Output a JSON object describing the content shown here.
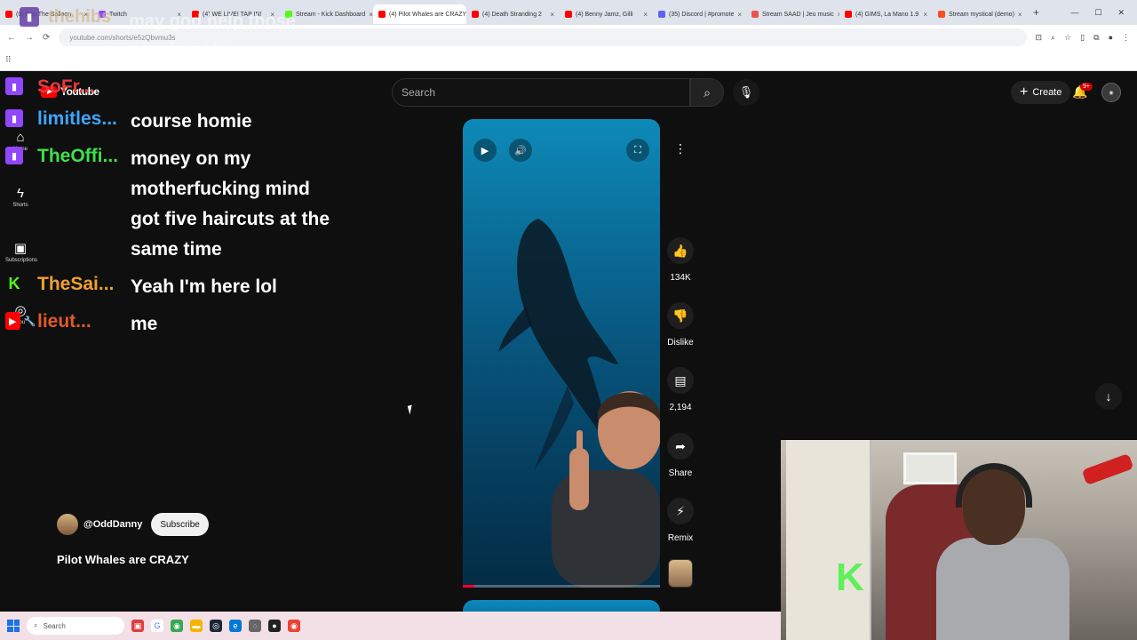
{
  "browser": {
    "tabs": [
      {
        "label": "(0) Pop The Balloon",
        "color": "#ff0000",
        "active": false
      },
      {
        "label": "Twitch",
        "color": "#9146ff",
        "active": false
      },
      {
        "label": "(4) WE LIVE! TAP IN!",
        "color": "#ff0000",
        "active": false
      },
      {
        "label": "Stream - Kick Dashboard",
        "color": "#53fc18",
        "active": false
      },
      {
        "label": "(4) Pilot Whales are CRAZY",
        "color": "#ff0000",
        "active": true
      },
      {
        "label": "(4) Death Stranding 2",
        "color": "#ff0000",
        "active": false
      },
      {
        "label": "(4) Benny Jamz, Gilli",
        "color": "#ff0000",
        "active": false
      },
      {
        "label": "(35) Discord | #promote",
        "color": "#5865f2",
        "active": false
      },
      {
        "label": "Stream SAAD | Jeu music",
        "color": "#e8544e",
        "active": false
      },
      {
        "label": "(4) GIMS, La Mano 1.9",
        "color": "#ff0000",
        "active": false
      },
      {
        "label": "Stream mystical (demo)",
        "color": "#f4511e",
        "active": false
      }
    ],
    "url": "youtube.com/shorts/e5zQbvmu3s"
  },
  "overlay": {
    "top_user": "thehibs",
    "top_message": "may god help those psychopats",
    "chat": [
      {
        "badges": [
          "twitch"
        ],
        "user": "SoFr...",
        "user_color": "#e23b3b",
        "message": ""
      },
      {
        "badges": [
          "twitch"
        ],
        "user": "limitles...",
        "user_color": "#3ea6ff",
        "message": "course homie"
      },
      {
        "badges": [
          "twitch"
        ],
        "user": "TheOffi...",
        "user_color": "#3fe04a",
        "message": "money on my motherfucking mind got five haircuts at the same time"
      },
      {
        "badges": [
          "kick"
        ],
        "user": "TheSai...",
        "user_color": "#f0a030",
        "message": "Yeah I'm here lol"
      },
      {
        "badges": [
          "youtube",
          "wrench"
        ],
        "user": "lieut...",
        "user_color": "#e05a2c",
        "message": "me"
      }
    ]
  },
  "youtube": {
    "logo_text": "Youtube",
    "search_placeholder": "Search",
    "create_label": "Create",
    "notif_count": "9+",
    "sidebar": [
      {
        "label": "Home",
        "icon": "home-icon"
      },
      {
        "label": "Shorts",
        "icon": "shorts-icon"
      },
      {
        "label": "Subscriptions",
        "icon": "subscriptions-icon"
      },
      {
        "label": "You",
        "icon": "you-icon"
      }
    ],
    "short": {
      "likes": "134K",
      "dislike_label": "Dislike",
      "comments": "2,194",
      "share_label": "Share",
      "remix_label": "Remix",
      "progress": 0.06
    },
    "channel": "@OddDanny",
    "subscribe_label": "Subscribe",
    "title": "Pilot Whales are CRAZY"
  },
  "taskbar": {
    "search_label": "Search"
  }
}
